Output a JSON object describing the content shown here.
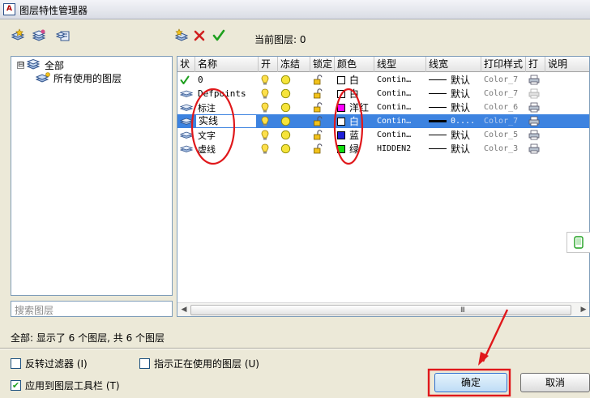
{
  "window": {
    "title": "图层特性管理器",
    "app_icon_text": "A"
  },
  "toolbar_left": [
    {
      "name": "new-property-filter-icon",
      "color": "#3b7dd8"
    },
    {
      "name": "new-group-filter-icon",
      "color": "#3b7dd8"
    },
    {
      "name": "layer-states-manager-icon",
      "color": "#3b7dd8"
    }
  ],
  "toolbar_right": [
    {
      "name": "new-layer-icon",
      "color": "#3b7dd8"
    },
    {
      "name": "delete-layer-icon",
      "color": "#d02020"
    },
    {
      "name": "set-current-icon",
      "color": "#1ea01e"
    }
  ],
  "current_layer": {
    "label": "当前图层: 0"
  },
  "tree": {
    "root": {
      "expander": "⊟",
      "label": "全部"
    },
    "child": {
      "label": "所有使用的图层"
    }
  },
  "search": {
    "placeholder": "搜索图层"
  },
  "grid": {
    "headers": [
      "状",
      "名称",
      "开",
      "冻结",
      "锁定",
      "颜色",
      "线型",
      "线宽",
      "打印样式",
      "打",
      "说明"
    ],
    "rows": [
      {
        "status": "current",
        "name": "0",
        "on": true,
        "color_name": "白",
        "color_hex": "#ffffff",
        "linetype": "Contin…",
        "lineweight": "默认",
        "plot_style": "Color_7",
        "plot": true,
        "selected": false
      },
      {
        "status": "layer",
        "name": "Defpoints",
        "on": true,
        "color_name": "白",
        "color_hex": "#ffffff",
        "linetype": "Contin…",
        "lineweight": "默认",
        "plot_style": "Color_7",
        "plot": false,
        "selected": false
      },
      {
        "status": "layer",
        "name": "标注",
        "on": true,
        "color_name": "洋红",
        "color_hex": "#ff00ff",
        "linetype": "Contin…",
        "lineweight": "默认",
        "plot_style": "Color_6",
        "plot": true,
        "selected": false
      },
      {
        "status": "layer",
        "name": "实线",
        "on": true,
        "color_name": "白",
        "color_hex": "#ffffff",
        "linetype": "Contin…",
        "lineweight": "0....",
        "plot_style": "Color_7",
        "plot": true,
        "selected": true
      },
      {
        "status": "layer",
        "name": "文字",
        "on": true,
        "color_name": "蓝",
        "color_hex": "#1f1fd8",
        "linetype": "Contin…",
        "lineweight": "默认",
        "plot_style": "Color_5",
        "plot": true,
        "selected": false
      },
      {
        "status": "layer",
        "name": "虚线",
        "on": true,
        "color_name": "绿",
        "color_hex": "#11dd11",
        "linetype": "HIDDEN2",
        "lineweight": "默认",
        "plot_style": "Color_3",
        "plot": true,
        "selected": false
      }
    ]
  },
  "scrollbar": {
    "left_arrow": "◀",
    "right_arrow": "▶",
    "grip": "III"
  },
  "status_text": "全部: 显示了 6 个图层, 共 6 个图层",
  "options": {
    "invert_filter": {
      "label": "反转过滤器 (I)",
      "checked": false
    },
    "show_used": {
      "label": "指示正在使用的图层 (U)",
      "checked": false
    },
    "apply_toolbar": {
      "label": "应用到图层工具栏 (T)",
      "checked": true
    }
  },
  "buttons": {
    "ok": "确定",
    "cancel": "取消"
  },
  "annotation_color": "#e0181b"
}
